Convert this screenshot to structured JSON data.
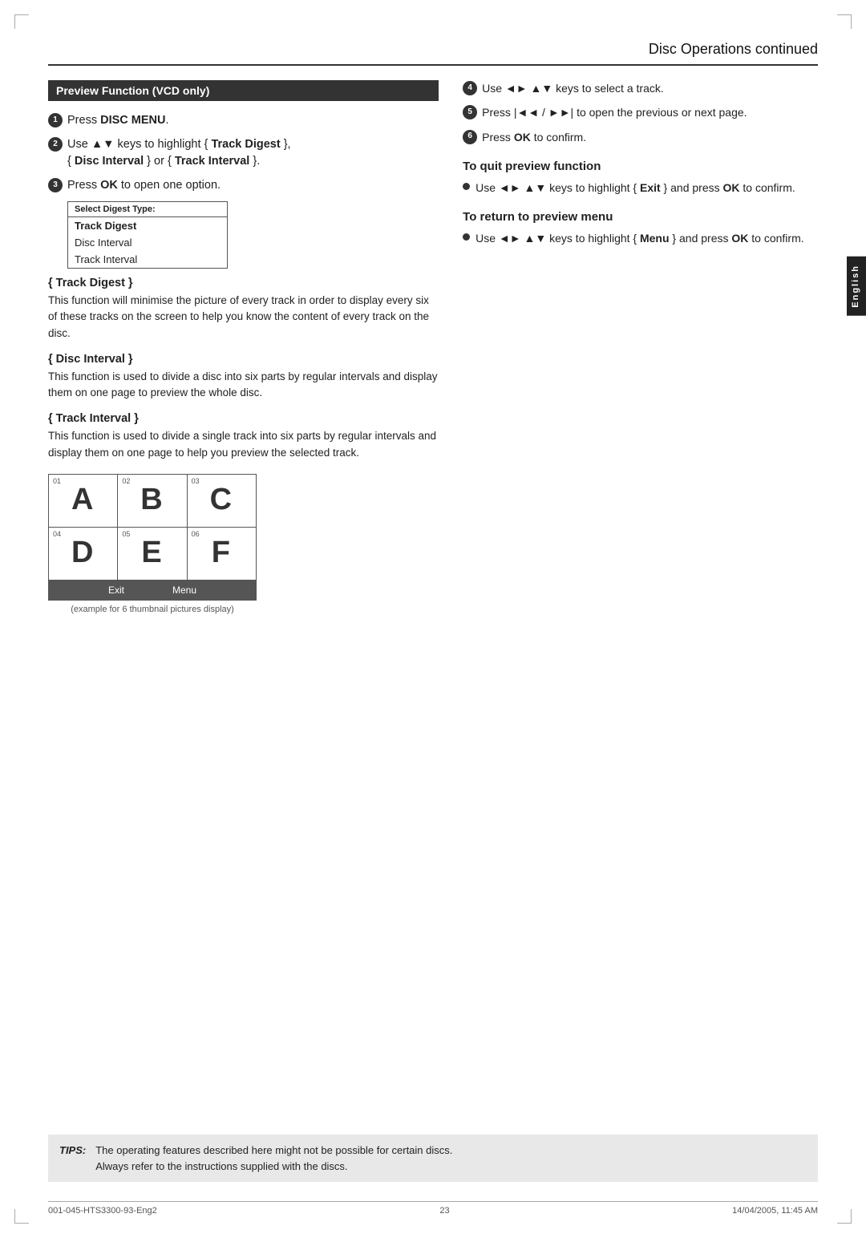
{
  "header": {
    "title": "Disc Operations",
    "subtitle": " continued"
  },
  "english_tab": "English",
  "left_col": {
    "section_title": "Preview Function (VCD only)",
    "steps": [
      {
        "num": "1",
        "text_before": "Press ",
        "bold": "DISC MENU",
        "text_after": "."
      },
      {
        "num": "2",
        "text_before": "Use ▲▼ keys to highlight { ",
        "bold": "Track Digest",
        "text_after": " },\n{ ",
        "bold2": "Disc Interval",
        "text_after2": " } or { ",
        "bold3": "Track Interval",
        "text_after3": " }."
      },
      {
        "num": "3",
        "text_before": "Press ",
        "bold": "OK",
        "text_after": " to open one option."
      }
    ],
    "digest_box": {
      "header": "Select Digest Type:",
      "items": [
        {
          "label": "Track Digest",
          "bold": true
        },
        {
          "label": "Disc Interval",
          "bold": false
        },
        {
          "label": "Track Interval",
          "bold": false
        }
      ]
    },
    "subsections": [
      {
        "title": "{ Track Digest }",
        "text": "This function will minimise the picture of every track in order to display every six of these tracks on the screen to help you know the content of every track on the disc."
      },
      {
        "title": "{ Disc Interval }",
        "text": "This function is used to divide a disc into six parts by regular intervals and display them on one page to preview the whole disc."
      },
      {
        "title": "{ Track Interval }",
        "text": "This function is used to divide a single track into six parts by regular intervals and display them on one page to help you preview the selected track."
      }
    ],
    "thumb_grid": {
      "cells": [
        {
          "num": "01",
          "letter": "A"
        },
        {
          "num": "02",
          "letter": "B"
        },
        {
          "num": "03",
          "letter": "C"
        },
        {
          "num": "04",
          "letter": "D"
        },
        {
          "num": "05",
          "letter": "E"
        },
        {
          "num": "06",
          "letter": "F"
        }
      ],
      "footer": [
        "Exit",
        "Menu"
      ],
      "caption": "(example for 6 thumbnail pictures display)"
    }
  },
  "right_col": {
    "steps": [
      {
        "num": "4",
        "text": "Use ◄► ▲▼ keys to select a track."
      },
      {
        "num": "5",
        "text_before": "Press |◄◄ / ►►| to open the previous or next page."
      },
      {
        "num": "6",
        "text_before": "Press ",
        "bold": "OK",
        "text_after": " to confirm."
      }
    ],
    "quit_section": {
      "heading": "To quit preview function",
      "bullet": "Use ◄► ▲▼ keys to highlight { Exit } and press OK to confirm."
    },
    "return_section": {
      "heading": "To return to preview menu",
      "bullet": "Use ◄► ▲▼ keys to highlight { Menu } and press OK to confirm."
    }
  },
  "tips": {
    "label": "TIPS:",
    "text": "The operating features described here might not be possible for certain discs.\nAlways refer to the instructions supplied with the discs."
  },
  "footer": {
    "left": "001-045-HTS3300-93-Eng2",
    "center": "23",
    "right": "14/04/2005, 11:45 AM"
  },
  "page_number": "23"
}
